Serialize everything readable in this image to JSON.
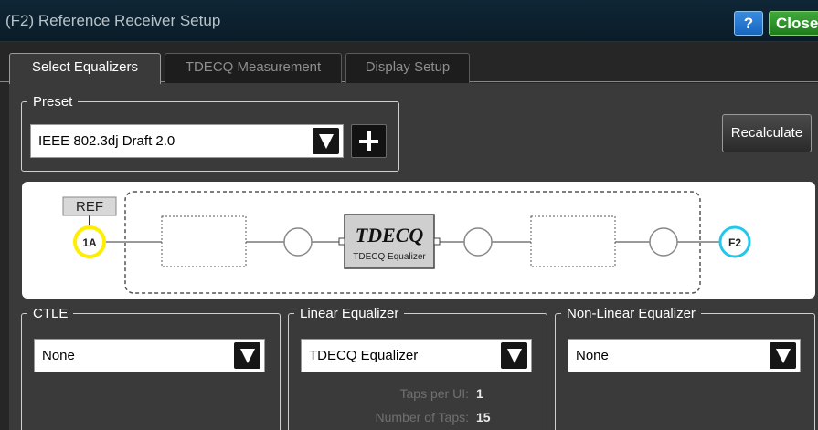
{
  "window": {
    "title": "(F2) Reference Receiver Setup",
    "help_label": "?",
    "close_label": "Close"
  },
  "tabs": [
    {
      "label": "Select Equalizers",
      "active": true
    },
    {
      "label": "TDECQ Measurement",
      "active": false
    },
    {
      "label": "Display Setup",
      "active": false
    }
  ],
  "preset": {
    "legend": "Preset",
    "value": "IEEE 802.3dj Draft 2.0"
  },
  "recalculate_label": "Recalculate",
  "diagram": {
    "ref_label": "REF",
    "source_label": "1A",
    "block_title": "TDECQ",
    "block_subtitle": "TDECQ Equalizer",
    "dest_label": "F2"
  },
  "ctle": {
    "legend": "CTLE",
    "value": "None"
  },
  "linear_equalizer": {
    "legend": "Linear Equalizer",
    "value": "TDECQ Equalizer",
    "taps_per_ui_label": "Taps per UI:",
    "taps_per_ui_value": "1",
    "number_of_taps_label": "Number of Taps:",
    "number_of_taps_value": "15"
  },
  "nonlinear_equalizer": {
    "legend": "Non-Linear Equalizer",
    "value": "None"
  },
  "colors": {
    "accent_blue": "#1666bf",
    "close_green": "#1f7d1b",
    "source_node": "#ffee00",
    "dest_node": "#22c7ee"
  }
}
